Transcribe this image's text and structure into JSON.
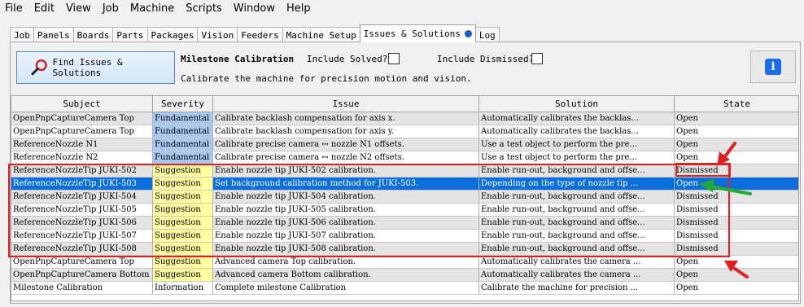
{
  "menu": [
    "File",
    "Edit",
    "View",
    "Job",
    "Machine",
    "Scripts",
    "Window",
    "Help"
  ],
  "tabs": [
    {
      "label": "Job"
    },
    {
      "label": "Panels"
    },
    {
      "label": "Boards"
    },
    {
      "label": "Parts"
    },
    {
      "label": "Packages"
    },
    {
      "label": "Vision"
    },
    {
      "label": "Feeders"
    },
    {
      "label": "Machine Setup"
    },
    {
      "label": "Issues & Solutions",
      "active": true,
      "has_dot": true
    },
    {
      "label": "Log"
    }
  ],
  "toolbar": {
    "find_label": "Find Issues & Solutions",
    "milestone_title": "Milestone Calibration",
    "milestone_desc": "Calibrate the machine for precision motion and vision.",
    "include_solved_label": "Include Solved?",
    "include_dismissed_label": "Include Dismissed?",
    "include_solved": false,
    "include_dismissed": false,
    "info_icon": "info-icon"
  },
  "table": {
    "columns": [
      "Subject",
      "Severity",
      "Issue",
      "Solution",
      "State"
    ],
    "rows": [
      {
        "subject": "OpenPnpCaptureCamera Top",
        "severity": "Fundamental",
        "issue": "Calibrate backlash compensation for axis x.",
        "solution": "Automatically calibrates the backlas...",
        "state": "Open"
      },
      {
        "subject": "OpenPnpCaptureCamera Top",
        "severity": "Fundamental",
        "issue": "Calibrate backlash compensation for axis y.",
        "solution": "Automatically calibrates the backlas...",
        "state": "Open"
      },
      {
        "subject": "ReferenceNozzle N1",
        "severity": "Fundamental",
        "issue": "Calibrate precise camera ↔ nozzle N1 offsets.",
        "solution": "Use a test object to perform the pre...",
        "state": "Open"
      },
      {
        "subject": "ReferenceNozzle N2",
        "severity": "Fundamental",
        "issue": "Calibrate precise camera ↔ nozzle N2 offsets.",
        "solution": "Use a test object to perform the pre...",
        "state": "Open"
      },
      {
        "subject": "ReferenceNozzleTip JUKI-502",
        "severity": "Suggestion",
        "issue": "Enable nozzle tip JUKI-502 calibration.",
        "solution": "Enable run-out, background and offse...",
        "state": "Dismissed"
      },
      {
        "subject": "ReferenceNozzleTip JUKI-503",
        "severity": "Suggestion",
        "issue": "Set background calibration method for JUKI-503.",
        "solution": "Depending on the type of nozzle tip ...",
        "state": "Open",
        "selected": true
      },
      {
        "subject": "ReferenceNozzleTip JUKI-504",
        "severity": "Suggestion",
        "issue": "Enable nozzle tip JUKI-504 calibration.",
        "solution": "Enable run-out, background and offse...",
        "state": "Dismissed"
      },
      {
        "subject": "ReferenceNozzleTip JUKI-505",
        "severity": "Suggestion",
        "issue": "Enable nozzle tip JUKI-505 calibration.",
        "solution": "Enable run-out, background and offse...",
        "state": "Dismissed"
      },
      {
        "subject": "ReferenceNozzleTip JUKI-506",
        "severity": "Suggestion",
        "issue": "Enable nozzle tip JUKI-506 calibration.",
        "solution": "Enable run-out, background and offse...",
        "state": "Dismissed"
      },
      {
        "subject": "ReferenceNozzleTip JUKI-507",
        "severity": "Suggestion",
        "issue": "Enable nozzle tip JUKI-507 calibration.",
        "solution": "Enable run-out, background and offse...",
        "state": "Dismissed"
      },
      {
        "subject": "ReferenceNozzleTip JUKI-508",
        "severity": "Suggestion",
        "issue": "Enable nozzle tip JUKI-508 calibration.",
        "solution": "Enable run-out, background and offse...",
        "state": "Dismissed"
      },
      {
        "subject": "OpenPnpCaptureCamera Top",
        "severity": "Suggestion",
        "issue": "Advanced camera Top calibration.",
        "solution": "Automatically calibrates the camera ...",
        "state": "Open"
      },
      {
        "subject": "OpenPnpCaptureCamera Bottom",
        "severity": "Suggestion",
        "issue": "Advanced camera Bottom calibration.",
        "solution": "Automatically calibrates the camera ...",
        "state": "Open"
      },
      {
        "subject": "Milestone Calibration",
        "severity": "Information",
        "issue": "Complete milestone Calibration",
        "solution": "Calibrate the machine for precision ...",
        "state": "Open"
      }
    ]
  },
  "colors": {
    "selected_row": "#0a6fdd",
    "fundamental": "#a8c8f0",
    "suggestion": "#ffffa0",
    "annotation_red": "#e02020",
    "annotation_green": "#22aa33"
  }
}
